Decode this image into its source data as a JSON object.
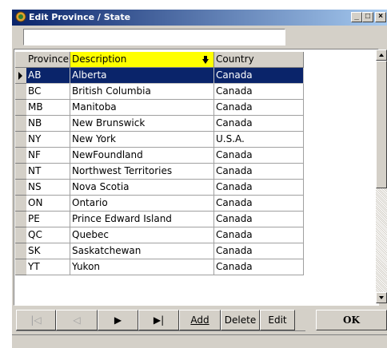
{
  "window": {
    "title": "Edit Province / State",
    "minimize_glyph": "_",
    "maximize_glyph": "□",
    "close_glyph": "×"
  },
  "search": {
    "value": ""
  },
  "grid": {
    "columns": [
      "Province",
      "Description",
      "Country"
    ],
    "sorted_column": "Description",
    "rows": [
      [
        "AB",
        "Alberta",
        "Canada"
      ],
      [
        "BC",
        "British Columbia",
        "Canada"
      ],
      [
        "MB",
        "Manitoba",
        "Canada"
      ],
      [
        "NB",
        "New Brunswick",
        "Canada"
      ],
      [
        "NY",
        "New York",
        "U.S.A."
      ],
      [
        "NF",
        "NewFoundland",
        "Canada"
      ],
      [
        "NT",
        "Northwest Territories",
        "Canada"
      ],
      [
        "NS",
        "Nova Scotia",
        "Canada"
      ],
      [
        "ON",
        "Ontario",
        "Canada"
      ],
      [
        "PE",
        "Prince Edward Island",
        "Canada"
      ],
      [
        "QC",
        "Quebec",
        "Canada"
      ],
      [
        "SK",
        "Saskatchewan",
        "Canada"
      ],
      [
        "YT",
        "Yukon",
        "Canada"
      ]
    ],
    "selected_row": 0
  },
  "navigator": {
    "first_glyph": "|◁",
    "prior_glyph": "◁",
    "next_glyph": "▶",
    "last_glyph": "▶|",
    "add": "Add",
    "delete": "Delete",
    "edit": "Edit"
  },
  "ok_label": "OK",
  "colors": {
    "title_start": "#0a246a",
    "title_end": "#a6caf0",
    "selection": "#0a246a",
    "sorted_header": "#ffff00",
    "face": "#d4d0c8"
  }
}
